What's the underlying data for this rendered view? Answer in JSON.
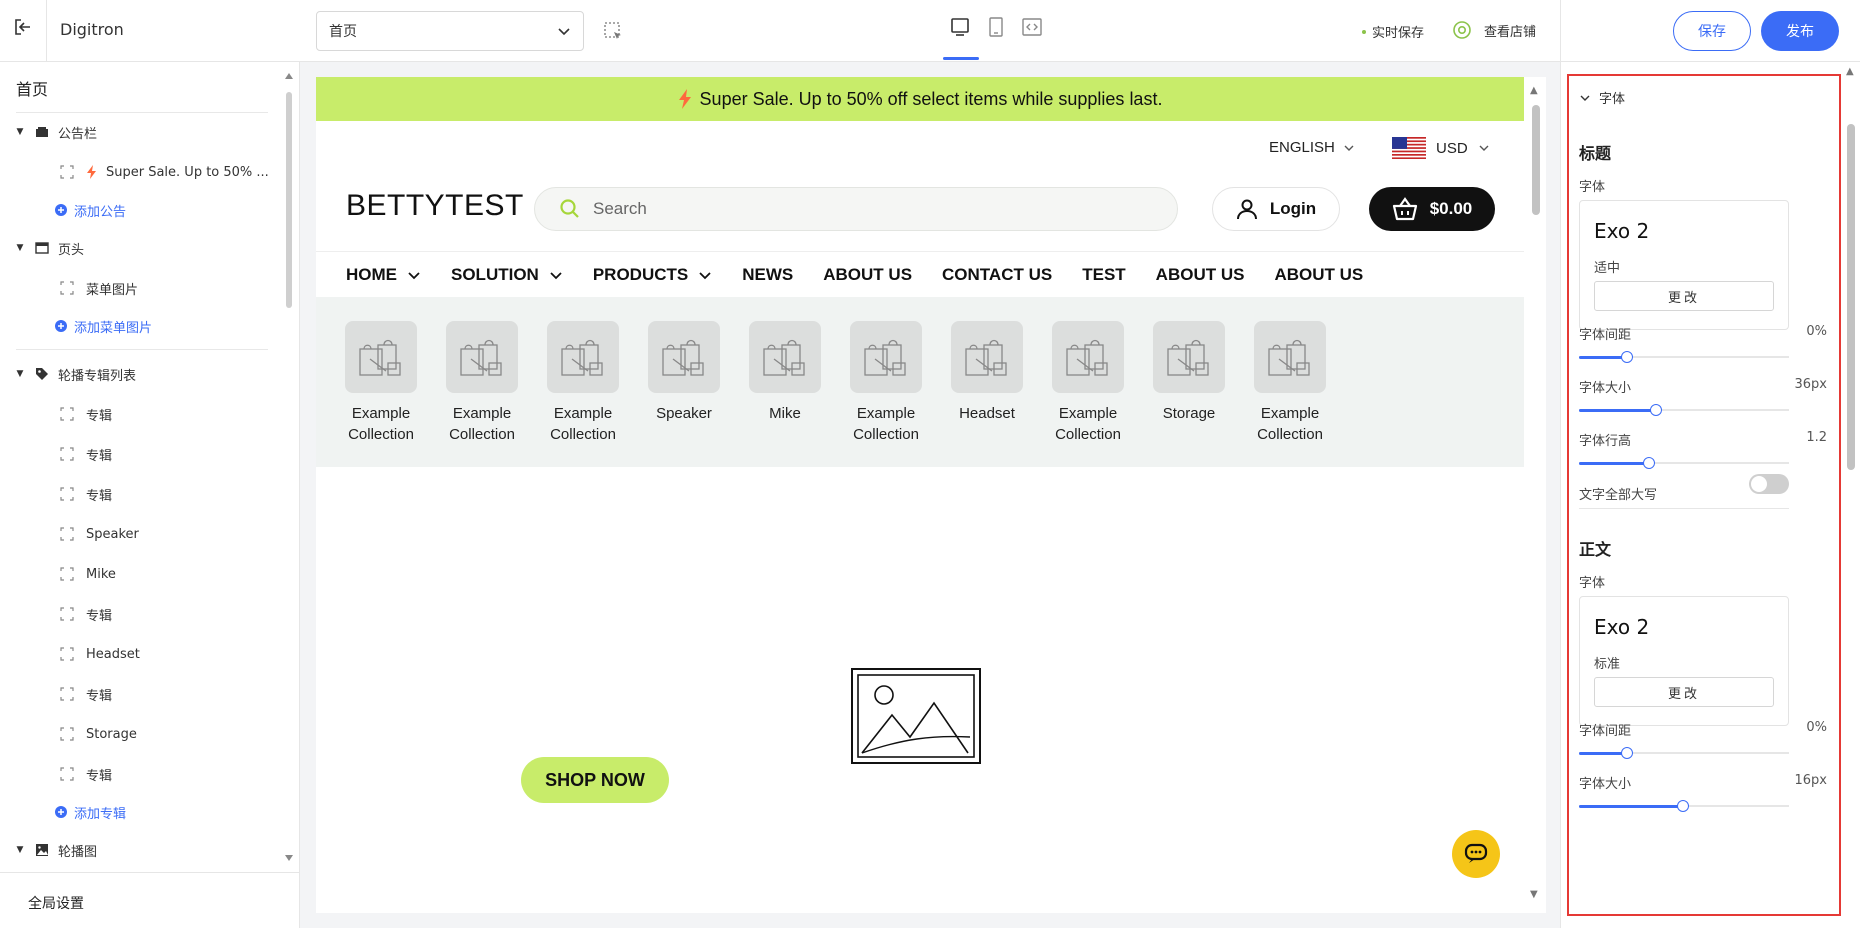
{
  "topbar": {
    "app_title": "Digitron",
    "page_select": "首页",
    "autosave": "实时保存",
    "view_store": "查看店铺",
    "save": "保存",
    "publish": "发布"
  },
  "sidebar": {
    "home": "首页",
    "announcement_group": "公告栏",
    "announcement_item": "Super Sale. Up to 50% ...",
    "add_announcement": "添加公告",
    "header_group": "页头",
    "header_item": "菜单图片",
    "add_menu_image": "添加菜单图片",
    "carousel_collection_group": "轮播专辑列表",
    "collection_items": [
      "专辑",
      "专辑",
      "专辑",
      "Speaker",
      "Mike",
      "专辑",
      "Headset",
      "专辑",
      "Storage",
      "专辑"
    ],
    "add_collection": "添加专辑",
    "carousel_group": "轮播图",
    "global_settings": "全局设置"
  },
  "preview": {
    "announcement": "Super Sale. Up to 50% off select items while supplies last.",
    "language": "ENGLISH",
    "currency": "USD",
    "logo": "BETTYTEST",
    "search_placeholder": "Search",
    "login": "Login",
    "cart_total": "$0.00",
    "nav": [
      "HOME",
      "SOLUTION",
      "PRODUCTS",
      "NEWS",
      "ABOUT US",
      "CONTACT US",
      "TEST",
      "ABOUT US",
      "ABOUT US"
    ],
    "collections": [
      [
        "Example",
        "Collection"
      ],
      [
        "Example",
        "Collection"
      ],
      [
        "Example",
        "Collection"
      ],
      [
        "Speaker",
        ""
      ],
      [
        "Mike",
        ""
      ],
      [
        "Example",
        "Collection"
      ],
      [
        "Headset",
        ""
      ],
      [
        "Example",
        "Collection"
      ],
      [
        "Storage",
        ""
      ],
      [
        "Example",
        "Collection"
      ]
    ],
    "shop_now": "SHOP NOW"
  },
  "panel": {
    "section_title": "字体",
    "heading": {
      "title": "标题",
      "font_label": "字体",
      "font_name": "Exo 2",
      "font_weight": "适中",
      "change": "更改",
      "letter_spacing_label": "字体间距",
      "letter_spacing_value": "0%",
      "size_label": "字体大小",
      "size_value": "36px",
      "line_height_label": "字体行高",
      "line_height_value": "1.2",
      "uppercase_label": "文字全部大写"
    },
    "body": {
      "title": "正文",
      "font_label": "字体",
      "font_name": "Exo 2",
      "font_weight": "标准",
      "change": "更改",
      "letter_spacing_label": "字体间距",
      "letter_spacing_value": "0%",
      "size_label": "字体大小",
      "size_value": "16px"
    }
  },
  "colors": {
    "accent": "#3b6cf6",
    "lime": "#c8ec6a",
    "highlight_border": "#e53935",
    "chat": "#f5c518"
  }
}
